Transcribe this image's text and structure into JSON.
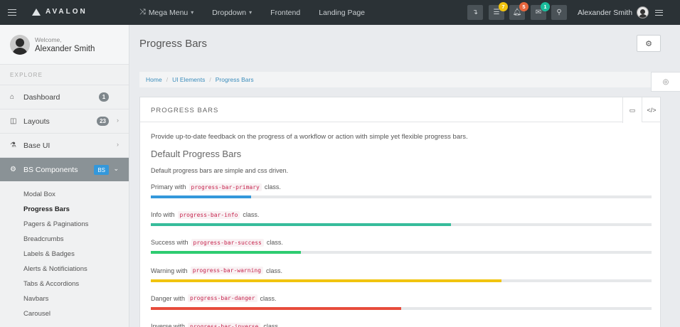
{
  "topbar": {
    "brand": "AVALON",
    "nav": [
      {
        "label": "Mega Menu",
        "caret": "▾"
      },
      {
        "label": "Dropdown",
        "caret": "▾"
      },
      {
        "label": "Frontend"
      },
      {
        "label": "Landing Page"
      }
    ],
    "badges": {
      "list": "7",
      "bell": "5",
      "mail": "1"
    },
    "badge_colors": {
      "list": "#f1c40f",
      "bell": "#e8663d",
      "mail": "#1abc9c"
    },
    "user_name": "Alexander Smith"
  },
  "sidebar": {
    "welcome": "Welcome,",
    "name": "Alexander Smith",
    "section": "EXPLORE",
    "items": [
      {
        "label": "Dashboard",
        "count": "1",
        "icon": "home-icon"
      },
      {
        "label": "Layouts",
        "count": "23",
        "icon": "columns-icon"
      },
      {
        "label": "Base UI",
        "icon": "flask-icon"
      },
      {
        "label": "BS Components",
        "tag": "BS",
        "icon": "cogs-icon"
      }
    ],
    "subitems": [
      "Modal Box",
      "Progress Bars",
      "Pagers & Paginations",
      "Breadcrumbs",
      "Labels & Badges",
      "Alerts & Notificiations",
      "Tabs & Accordions",
      "Navbars",
      "Carousel"
    ]
  },
  "page": {
    "title": "Progress Bars",
    "breadcrumb": [
      "Home",
      "UI Elements",
      "Progress Bars"
    ]
  },
  "panel": {
    "title": "PROGRESS BARS",
    "intro": "Provide up-to-date feedback on the progress of a workflow or action with simple yet flexible progress bars.",
    "heading": "Default Progress Bars",
    "desc": "Default progress bars are simple and css driven.",
    "bars": [
      {
        "prefix": "Primary with",
        "code": "progress-bar-primary",
        "suffix": "class.",
        "percent": 20,
        "color": "#3498db"
      },
      {
        "prefix": "Info with",
        "code": "progress-bar-info",
        "suffix": "class.",
        "percent": 60,
        "color": "#37bc9b"
      },
      {
        "prefix": "Success with",
        "code": "progress-bar-success",
        "suffix": "class.",
        "percent": 30,
        "color": "#2ecc71"
      },
      {
        "prefix": "Warning with",
        "code": "progress-bar-warning",
        "suffix": "class.",
        "percent": 70,
        "color": "#f1c40f"
      },
      {
        "prefix": "Danger with",
        "code": "progress-bar-danger",
        "suffix": "class.",
        "percent": 50,
        "color": "#e74c3c"
      },
      {
        "prefix": "Inverse with",
        "code": "progress-bar-inverse",
        "suffix": "class.",
        "percent": 0,
        "color": "#333333"
      }
    ]
  }
}
